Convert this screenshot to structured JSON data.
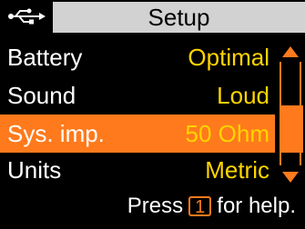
{
  "header": {
    "icon": "usb-icon",
    "title": "Setup"
  },
  "menu": [
    {
      "label": "Battery",
      "value": "Optimal",
      "selected": false
    },
    {
      "label": "Sound",
      "value": "Loud",
      "selected": false
    },
    {
      "label": "Sys. imp.",
      "value": "50 Ohm",
      "selected": true
    },
    {
      "label": "Units",
      "value": "Metric",
      "selected": false
    }
  ],
  "scrollbar": {
    "up_icon": "triangle-up-icon",
    "down_icon": "triangle-down-icon",
    "position": 0.55
  },
  "footer": {
    "prefix": "Press",
    "key": "1",
    "suffix": "for help."
  },
  "colors": {
    "accent": "#ff7a1c",
    "value": "#ffd400",
    "header_bg": "#d2d2d2"
  }
}
